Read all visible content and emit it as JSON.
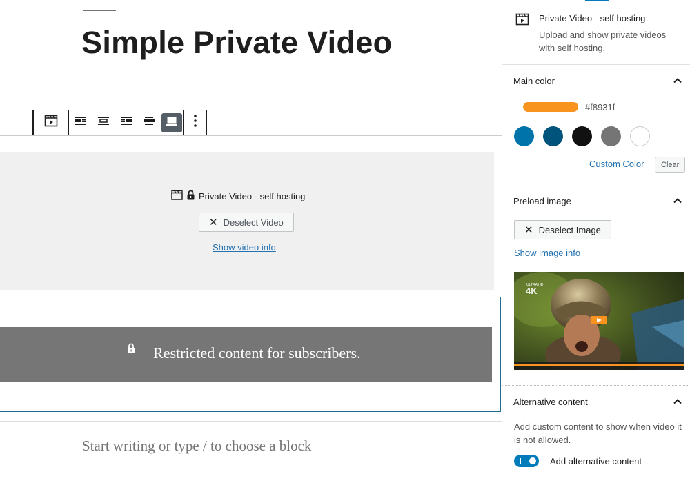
{
  "editor": {
    "post_title": "Simple Private Video",
    "video_block": {
      "label": "Private Video - self hosting",
      "deselect_label": "Deselect Video",
      "info_link": "Show video info"
    },
    "restricted_text": "Restricted content for subscribers.",
    "paragraph_placeholder": "Start writing or type / to choose a block"
  },
  "sidebar": {
    "block": {
      "title": "Private Video - self hosting",
      "description": "Upload and show private videos with self hosting."
    },
    "main_color": {
      "title": "Main color",
      "current_hex": "#f8931f",
      "swatches": [
        "#0073aa",
        "#00537a",
        "#111111",
        "#757575",
        "#ffffff"
      ],
      "custom_label": "Custom Color",
      "clear_label": "Clear"
    },
    "preload_image": {
      "title": "Preload image",
      "deselect_label": "Deselect Image",
      "info_link": "Show image info",
      "badge_small": "ULTRA HD",
      "badge_big": "4K"
    },
    "alternative_content": {
      "title": "Alternative content",
      "description": "Add custom content to show when video it is not allowed.",
      "toggle_label": "Add alternative content",
      "toggle_on": true
    }
  },
  "colors": {
    "accent": "#007cba",
    "link": "#2271b1",
    "restricted_bg": "#767676",
    "placeholder_bg": "#f0f0f1"
  }
}
